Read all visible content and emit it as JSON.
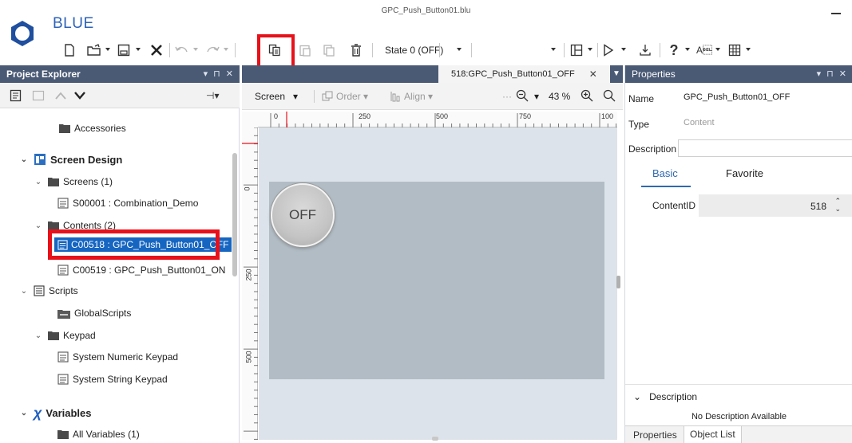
{
  "window": {
    "title": "GPC_Push_Button01.blu",
    "app_name": "BLUE"
  },
  "toolbar": {
    "state_label": "State 0 (OFF)",
    "icons": [
      "new-file-icon",
      "open-folder-icon",
      "save-icon",
      "close-icon",
      "undo-icon",
      "redo-icon",
      "copy-icon",
      "paste-icon",
      "duplicate-icon",
      "delete-icon",
      "layout-icon",
      "run-icon",
      "transfer-icon",
      "help-icon",
      "language-icon",
      "grid-icon"
    ]
  },
  "project_explorer": {
    "title": "Project Explorer",
    "tree": {
      "accessories": "Accessories",
      "screen_design": "Screen Design",
      "screens": "Screens (1)",
      "screen_item": "S00001 : Combination_Demo",
      "contents": "Contents (2)",
      "content_item_1": "C00518 : GPC_Push_Button01_OFF",
      "content_item_2": "C00519 : GPC_Push_Button01_ON",
      "scripts": "Scripts",
      "global_scripts": "GlobalScripts",
      "keypad": "Keypad",
      "numeric_keypad": "System Numeric Keypad",
      "string_keypad": "System String Keypad",
      "variables": "Variables",
      "all_variables": "All Variables (1)"
    }
  },
  "document": {
    "tab_title": "518:GPC_Push_Button01_OFF",
    "toolbar": {
      "screen": "Screen",
      "order": "Order",
      "align": "Align",
      "ellipsis": "···",
      "zoom": "43 %"
    },
    "ruler_top_labels": [
      "0",
      "250",
      "500",
      "750",
      "100"
    ],
    "ruler_left_labels": [
      "0",
      "250",
      "500"
    ],
    "button_text": "OFF"
  },
  "properties": {
    "title": "Properties",
    "name_label": "Name",
    "name_value": "GPC_Push_Button01_OFF",
    "type_label": "Type",
    "type_value": "Content",
    "description_label": "Description",
    "description_value": "",
    "tabs": {
      "basic": "Basic",
      "favorite": "Favorite"
    },
    "content_id_label": "ContentID",
    "content_id_value": "518",
    "description_section_title": "Description",
    "description_text": "No Description Available",
    "bottom_tabs": {
      "properties": "Properties",
      "object_list": "Object List"
    }
  },
  "colors": {
    "panel_header": "#4a5a75",
    "selection": "#1665c1",
    "brand": "#2c62b8",
    "highlight": "#e8111a"
  }
}
